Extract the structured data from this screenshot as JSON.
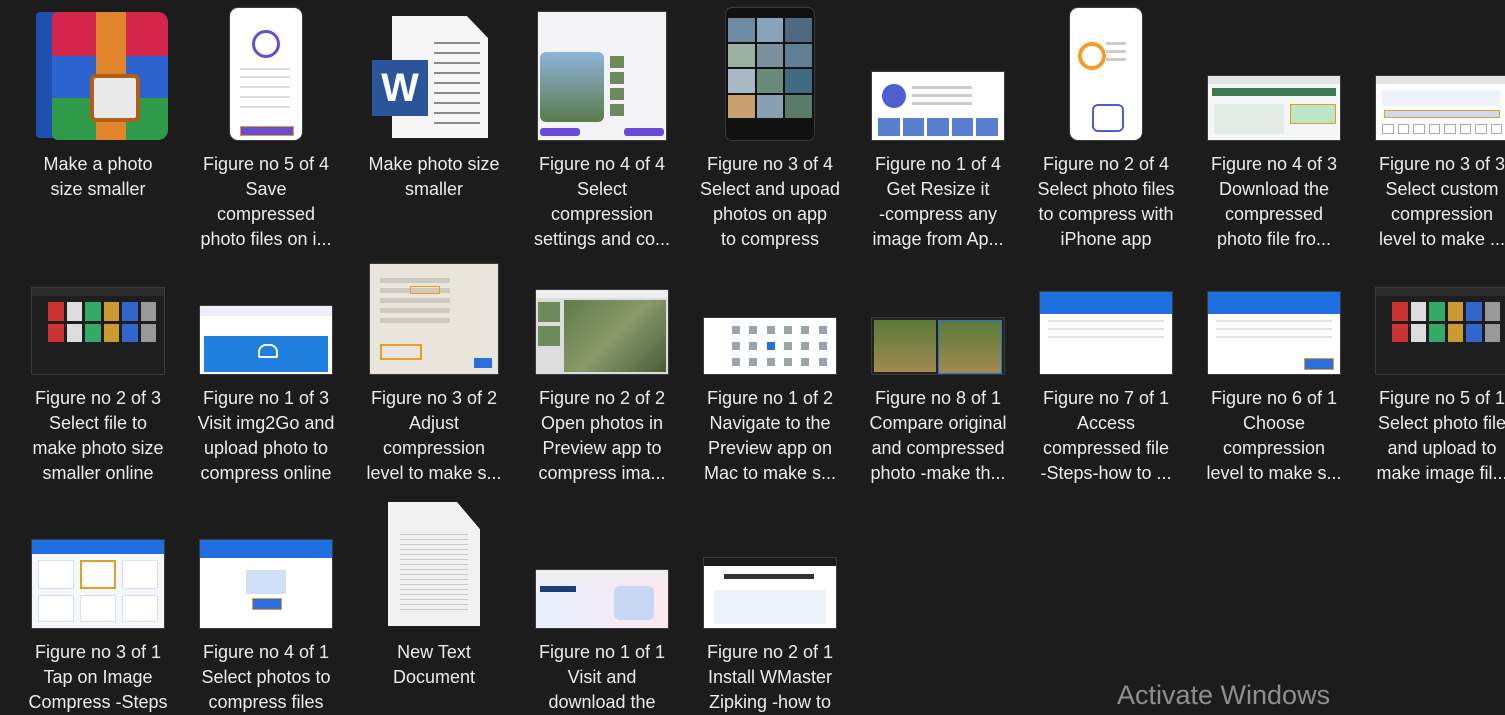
{
  "files": [
    {
      "label": "Make a photo\nsize smaller",
      "kind": "winrar-icon"
    },
    {
      "label": "Figure no 5 of 4\nSave\ncompressed\nphoto files on i...",
      "kind": "phone-shot-white"
    },
    {
      "label": "Make photo size\nsmaller",
      "kind": "word-icon"
    },
    {
      "label": "Figure no 4 of 4\nSelect\ncompression\nsettings and co...",
      "kind": "phone-shot-split"
    },
    {
      "label": "Figure no 3 of 4\nSelect and upoad\nphotos on app\nto compress",
      "kind": "phone-shot-gallery"
    },
    {
      "label": "Figure no 1 of 4\nGet Resize it\n-compress any\nimage from Ap...",
      "kind": "app-store-shot"
    },
    {
      "label": "Figure no 2 of 4\nSelect photo files\nto compress with\niPhone app",
      "kind": "phone-shot-storage"
    },
    {
      "label": "Figure no 4 of 3\nDownload the\ncompressed\nphoto file fro...",
      "kind": "web-shot-green"
    },
    {
      "label": "Figure no 3 of 3\nSelect custom\ncompression\nlevel to make ...",
      "kind": "web-shot-slider"
    },
    {
      "label": "Figure no 2 of 3\nSelect file to\nmake photo size\nsmaller online",
      "kind": "dark-shot"
    },
    {
      "label": "Figure no 1 of 3\nVisit img2Go and\nupload photo to\ncompress online",
      "kind": "web-shot-blue"
    },
    {
      "label": "Figure no 3 of 2\nAdjust\ncompression\nlevel to make s...",
      "kind": "dialog-shot"
    },
    {
      "label": "Figure no 2 of 2\nOpen photos in\nPreview app to\ncompress ima...",
      "kind": "preview-shot"
    },
    {
      "label": "Figure no 1 of 2\nNavigate to the\nPreview app on\nMac to make s...",
      "kind": "finder-shot"
    },
    {
      "label": "Figure no 8 of 1\nCompare original\nand compressed\nphoto -make th...",
      "kind": "compare-shot"
    },
    {
      "label": "Figure no 7 of 1\nAccess\ncompressed file\n-Steps-how to ...",
      "kind": "app-shot-blue"
    },
    {
      "label": "Figure no 6 of 1\nChoose\ncompression\nlevel to make s...",
      "kind": "app-shot-blue-b"
    },
    {
      "label": "Figure no 5 of 1\nSelect photo file\nand upload to\nmake image fil...",
      "kind": "dark-shot-b"
    },
    {
      "label": "Figure no 3 of 1\nTap on Image\nCompress -Steps",
      "kind": "app-shot-grid"
    },
    {
      "label": "Figure no 4 of 1\nSelect photos to\ncompress files",
      "kind": "app-shot-upload"
    },
    {
      "label": "New Text\nDocument",
      "kind": "text-doc-icon"
    },
    {
      "label": "Figure no 1 of 1\nVisit and\ndownload the",
      "kind": "web-shot-hero"
    },
    {
      "label": "Figure no 2 of 1\nInstall WMaster\nZipking -how to",
      "kind": "web-shot-install"
    }
  ],
  "watermark": "Activate Windows"
}
